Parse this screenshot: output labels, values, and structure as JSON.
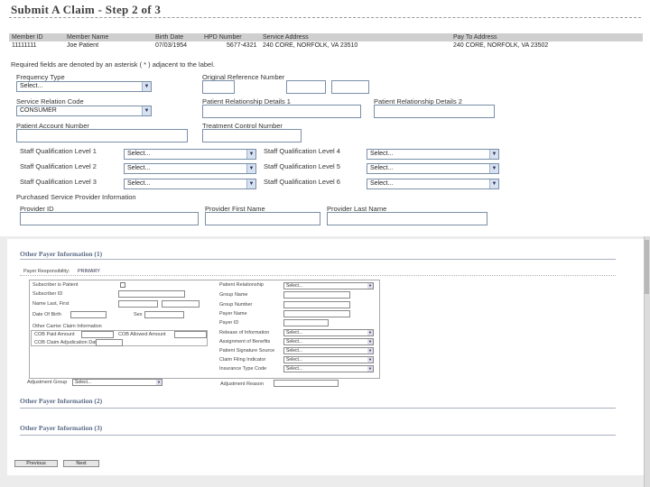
{
  "page": {
    "title": "Submit A Claim - Step 2 of 3",
    "required_note": "Required fields are denoted by an asterisk ( * ) adjacent to the label."
  },
  "member": {
    "headers": [
      "Member ID",
      "Member Name",
      "Birth Date",
      "HPD Number",
      "Service Address",
      "Pay To Address"
    ],
    "values": [
      "11111111",
      "Joe Patient",
      "07/03/1954",
      "5677-4321",
      "240 CORE, NORFOLK, VA 23510",
      "240 CORE, NORFOLK, VA 23502"
    ]
  },
  "form": {
    "frequency_type": {
      "label": "Frequency Type",
      "value": "Select..."
    },
    "original_ref": {
      "label": "Original Reference Number"
    },
    "service_relation": {
      "label": "Service Relation Code",
      "value": "CONSUMER"
    },
    "patient_rel_1": {
      "label": "Patient Relationship Details 1"
    },
    "patient_rel_2": {
      "label": "Patient Relationship Details 2"
    },
    "patient_account": {
      "label": "Patient Account Number"
    },
    "treatment_auth": {
      "label": "Treatment Control Number"
    },
    "staff": [
      {
        "label": "Staff Qualification Level 1",
        "value": "Select..."
      },
      {
        "label": "Staff Qualification Level 2",
        "value": "Select..."
      },
      {
        "label": "Staff Qualification Level 3",
        "value": "Select..."
      },
      {
        "label": "Staff Qualification Level 4",
        "value": "Select..."
      },
      {
        "label": "Staff Qualification Level 5",
        "value": "Select..."
      },
      {
        "label": "Staff Qualification Level 6",
        "value": "Select..."
      }
    ],
    "purchased_heading": "Purchased Service Provider Information",
    "provider_id": "Provider ID",
    "provider_first": "Provider First Name",
    "provider_last": "Provider Last Name"
  },
  "other_payer": {
    "section1": "Other Payer Information (1)",
    "section2": "Other Payer Information (2)",
    "section3": "Other Payer Information (3)",
    "responsibility_label": "Payer Responsibility:",
    "responsibility_value": "PRIMARY",
    "left_labels": [
      "Subscriber is Patient",
      "Subscriber ID",
      "Name Last, First",
      "Date Of Birth",
      "Sex"
    ],
    "claim_info_heading": "Other Carrier Claim Information",
    "cob_paid": "COB Paid Amount",
    "cob_allowed": "COB Allowed Amount",
    "cob_adj_date": "COB Claim Adjudication Date",
    "right_labels": [
      "Patient Relationship",
      "Group Name",
      "Group Number",
      "Payer Name",
      "Payer ID",
      "Release of Information",
      "Assignment of Benefits",
      "Patient Signature Source",
      "Claim Filing Indicator",
      "Insurance Type Code"
    ],
    "right_select_value": "Select...",
    "adjustment_group": "Adjustment Group",
    "adjustment_group_value": "Select...",
    "adjustment_reason": "Adjustment Reason"
  },
  "buttons": {
    "previous": "Previous",
    "next": "Next"
  }
}
